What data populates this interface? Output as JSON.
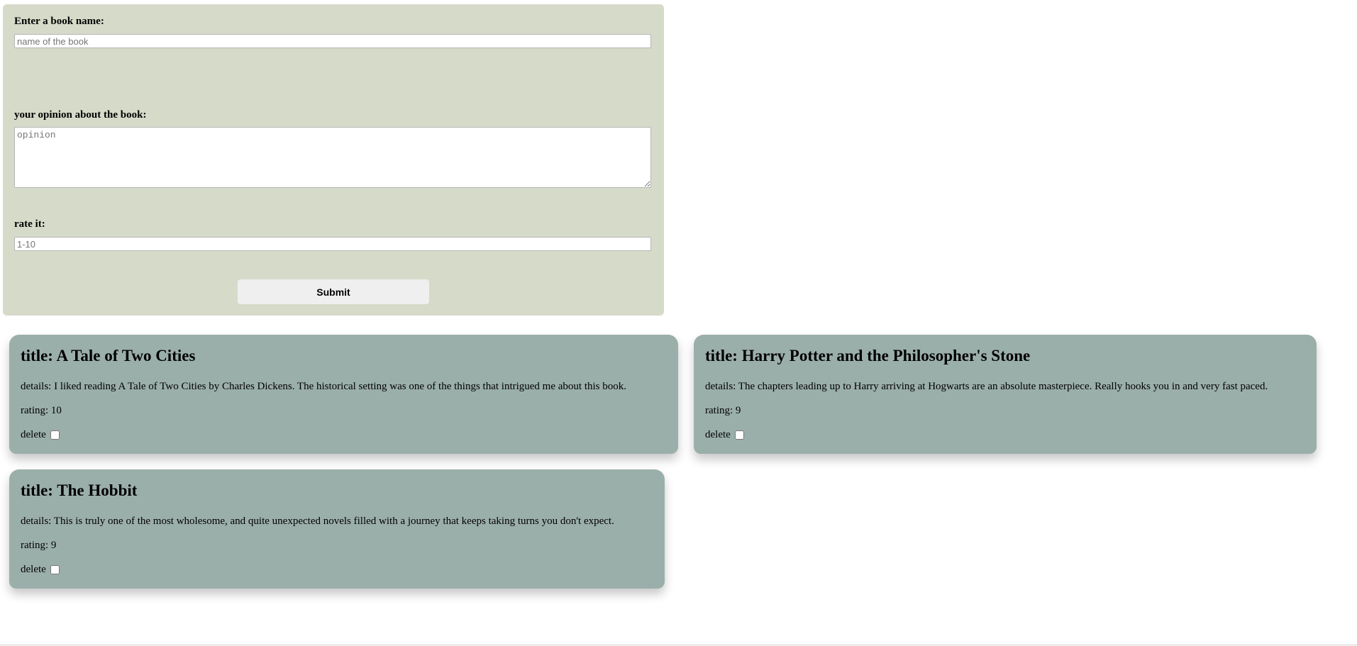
{
  "form": {
    "book_name_label": "Enter a book name:",
    "book_name_placeholder": "name of the book",
    "book_name_value": "",
    "opinion_label": "your opinion about the book:",
    "opinion_placeholder": "opinion",
    "opinion_value": "",
    "rate_label": "rate it:",
    "rate_placeholder": "1-10",
    "rate_value": "",
    "submit_label": "Submit"
  },
  "books": [
    {
      "title": "title: A Tale of Two Cities",
      "details": "details: I liked reading A Tale of Two Cities by Charles Dickens. The historical setting was one of the things that intrigued me about this book.",
      "rating": "rating: 10",
      "delete_label": "delete"
    },
    {
      "title": "title: Harry Potter and the Philosopher's Stone",
      "details": "details: The chapters leading up to Harry arriving at Hogwarts are an absolute masterpiece. Really hooks you in and very fast paced.",
      "rating": "rating: 9",
      "delete_label": "delete"
    },
    {
      "title": "title: The Hobbit",
      "details": "details: This is truly one of the most wholesome, and quite unexpected novels filled with a journey that keeps taking turns you don't expect.",
      "rating": "rating: 9",
      "delete_label": "delete"
    }
  ],
  "colors": {
    "form_background": "#d6dac9",
    "card_background": "#9bafaa",
    "button_background": "#efefef"
  }
}
